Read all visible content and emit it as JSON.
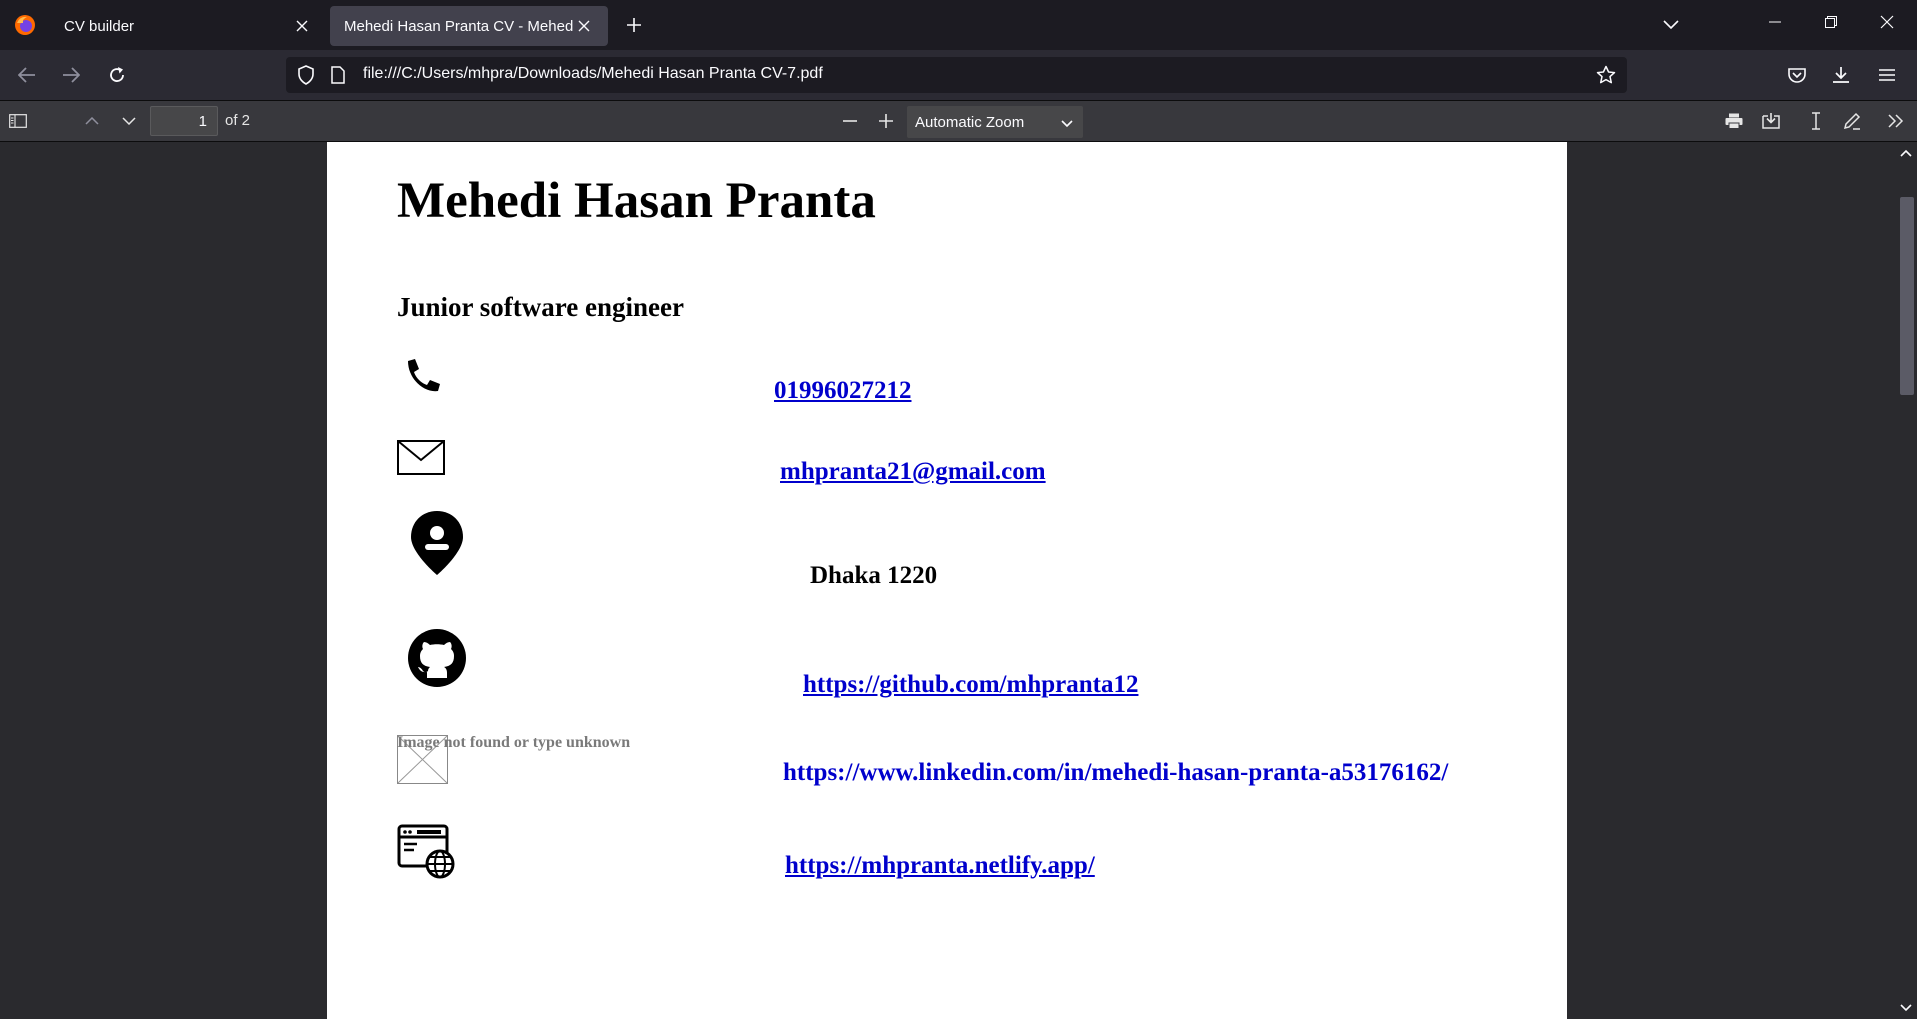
{
  "browser": {
    "tabs": [
      {
        "title": "CV builder",
        "active": false
      },
      {
        "title": "Mehedi Hasan Pranta CV - Mehedi Hasan Pranta",
        "active": true
      }
    ],
    "url": "file:///C:/Users/mhpra/Downloads/Mehedi Hasan Pranta CV-7.pdf"
  },
  "pdf_toolbar": {
    "page_number": "1",
    "page_count_label": "of 2",
    "zoom_label": "Automatic Zoom"
  },
  "cv": {
    "name": "Mehedi Hasan Pranta",
    "role": "Junior software engineer",
    "phone": "01996027212",
    "email": "mhpranta21@gmail.com",
    "location": "Dhaka 1220",
    "github": "https://github.com/mhpranta12",
    "broken_image_text": "Image not found or type unknown",
    "linkedin": "https://www.linkedin.com/in/mehedi-hasan-pranta-a53176162/",
    "website": "https://mhpranta.netlify.app/"
  },
  "colors": {
    "link": "#0000cc",
    "toolbar_bg": "#38383d",
    "tabstrip_bg": "#1c1b22"
  }
}
